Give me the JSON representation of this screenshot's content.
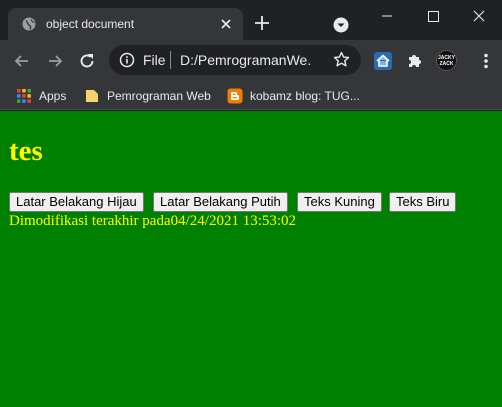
{
  "browser": {
    "tab": {
      "title": "object document"
    },
    "omnibox": {
      "scheme_label": "File",
      "url": "D:/PemrogramanWe..."
    },
    "bookmarks": [
      {
        "label": "Apps",
        "icon": "apps-grid-icon"
      },
      {
        "label": "Pemrograman Web",
        "icon": "folder-icon"
      },
      {
        "label": "kobamz blog: TUG...",
        "icon": "blogger-icon"
      }
    ],
    "profile": {
      "avatar_text_top": "JACKY",
      "avatar_text_bottom": "ZACK"
    }
  },
  "page": {
    "background_color": "#008000",
    "text_color": "#ffff00",
    "heading": "tes",
    "buttons": [
      {
        "label": "Latar Belakang Hijau"
      },
      {
        "label": "Latar Belakang Putih"
      },
      {
        "label": "Teks Kuning"
      },
      {
        "label": "Teks Biru"
      }
    ],
    "modified_prefix": "Dimodifikasi terakhir pada",
    "modified_datetime": "04/24/2021 13:53:02"
  }
}
